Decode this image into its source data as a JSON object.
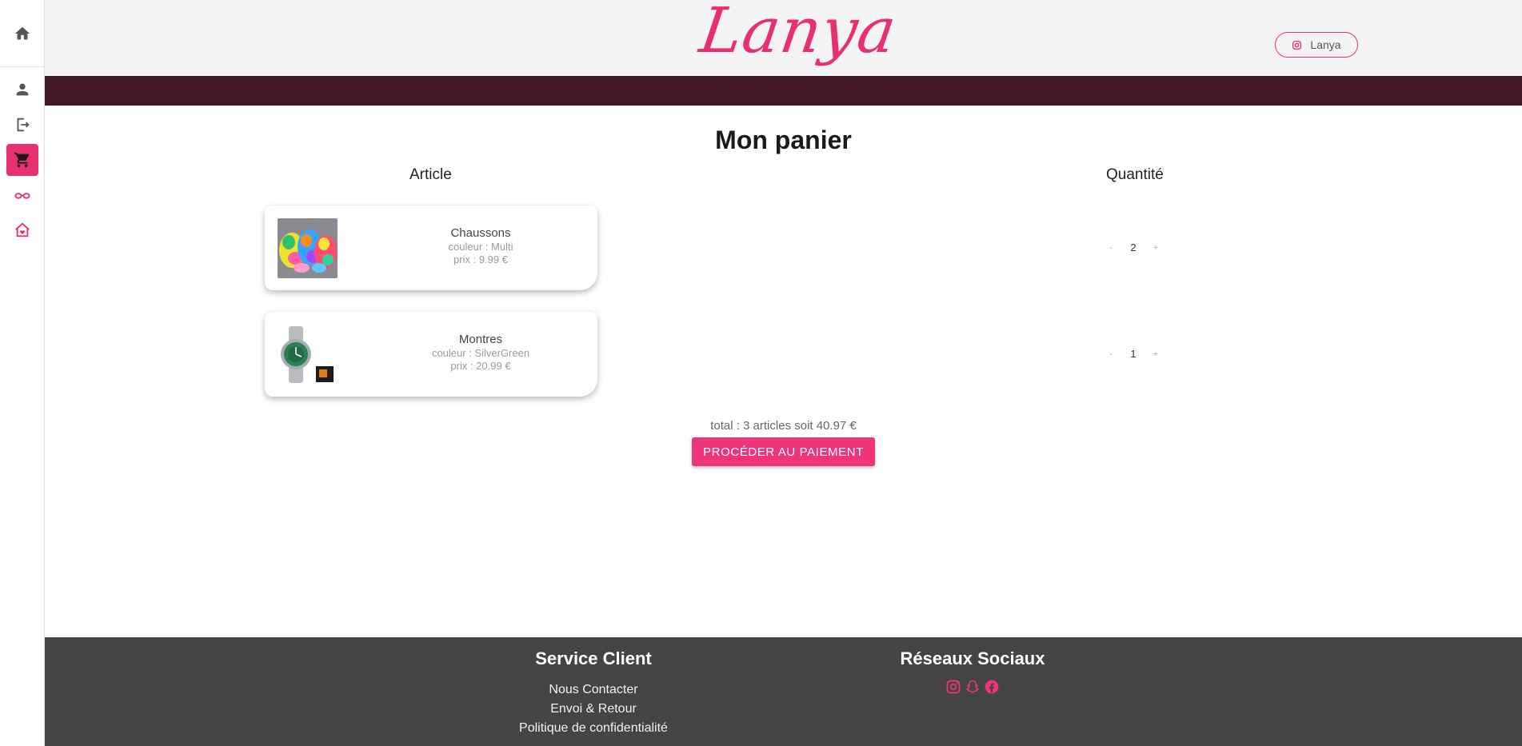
{
  "header": {
    "logo": "Lanya",
    "instagram_label": "Lanya"
  },
  "sidebar": {
    "items": [
      {
        "name": "home-icon",
        "active": false
      },
      {
        "name": "user-icon",
        "active": false
      },
      {
        "name": "logout-icon",
        "active": false
      },
      {
        "name": "cart-icon",
        "active": true
      },
      {
        "name": "glasses-icon",
        "active": false
      },
      {
        "name": "house-heart-icon",
        "active": false
      }
    ]
  },
  "cart": {
    "title": "Mon panier",
    "col_article": "Article",
    "col_quantity": "Quantité",
    "items": [
      {
        "name": "Chaussons",
        "color": "couleur : Multi",
        "price": "prix : 9.99 €",
        "quantity": "2",
        "minus": "-",
        "plus": "+"
      },
      {
        "name": "Montres",
        "color": "couleur : SilverGreen",
        "price": "prix : 20.99 €",
        "quantity": "1",
        "minus": "-",
        "plus": "+"
      }
    ],
    "total": "total : 3 articles soit 40.97 €",
    "pay_button": "PROCÉDER AU PAIEMENT"
  },
  "footer": {
    "service": {
      "title": "Service Client",
      "links": [
        "Nous Contacter",
        "Envoi & Retour",
        "Politique de confidentialité"
      ]
    },
    "social": {
      "title": "Réseaux Sociaux",
      "icons": [
        "instagram-icon",
        "snapchat-icon",
        "facebook-icon"
      ]
    }
  },
  "colors": {
    "accent": "#e8306d",
    "band": "#441522",
    "footer": "#444444",
    "header_bg": "#f5f4f4"
  }
}
